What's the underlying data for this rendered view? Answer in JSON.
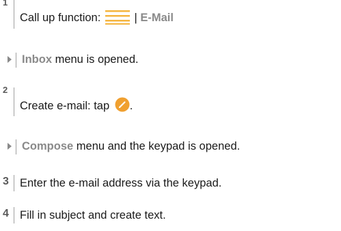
{
  "steps": [
    {
      "num": "1",
      "text_before": "Call up function: ",
      "sep": " | ",
      "keyword": "E-Mail"
    },
    {
      "result_keyword": "Inbox",
      "result_text": " menu is opened."
    },
    {
      "num": "2",
      "text_before": "Create e-mail: tap ",
      "text_after": "."
    },
    {
      "result_keyword": "Compose",
      "result_text": " menu and the keypad is opened."
    },
    {
      "num": "3",
      "text": "Enter the e-mail address via the keypad."
    },
    {
      "num": "4",
      "text": "Fill in subject and create text."
    }
  ],
  "icons": {
    "menu": "hamburger-menu-icon",
    "edit": "edit-pencil-icon"
  },
  "colors": {
    "accent_orange": "#f0a030",
    "menu_icon": "#f5b53f",
    "keyword_gray": "#8a8a8a"
  }
}
